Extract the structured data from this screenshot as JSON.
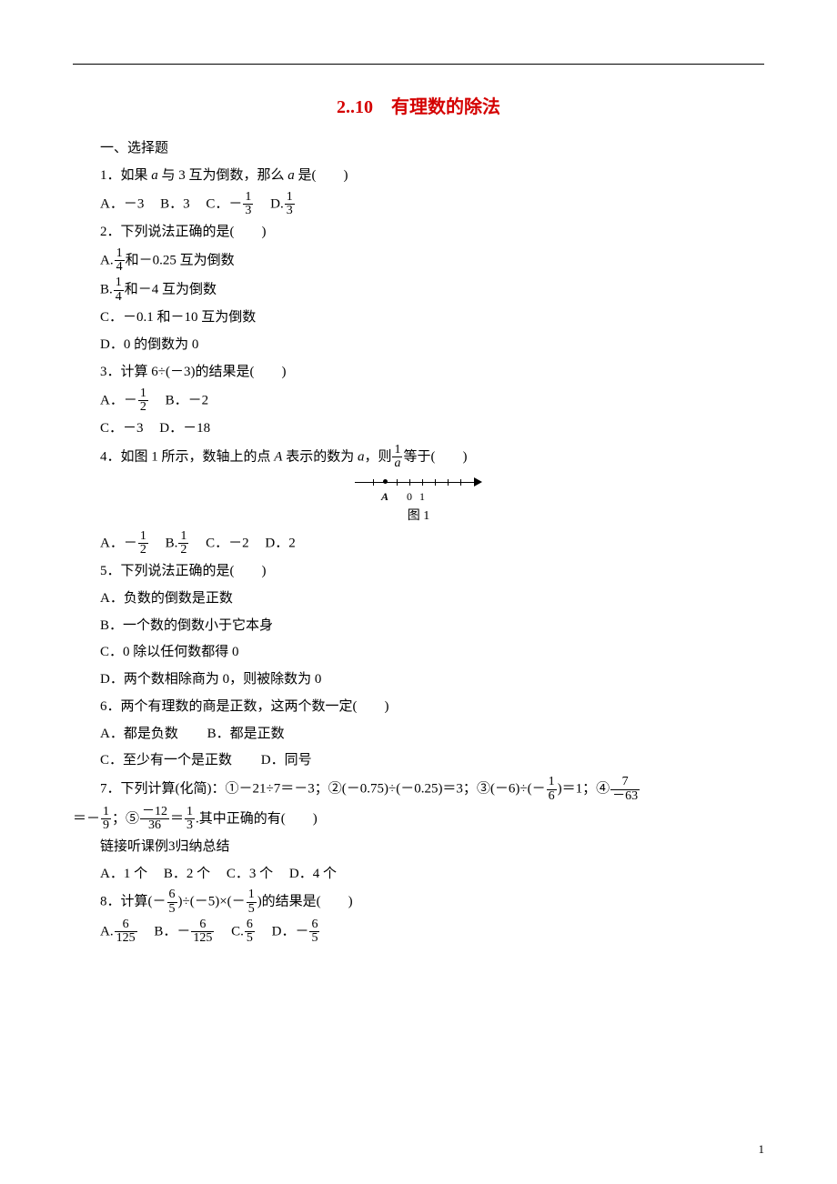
{
  "title": "2..10　有理数的除法",
  "section1": "一、选择题",
  "q1": {
    "stem_pre": "1．如果 ",
    "var_a": "a",
    "stem_mid": " 与 3 互为倒数，那么 ",
    "stem_end": " 是(　　)",
    "optA_pre": "A．－3",
    "optB_pre": "B．3",
    "optC_pre": "C．－",
    "optD_pre": "D.",
    "frac_num": "1",
    "frac_den": "3"
  },
  "q2": {
    "stem": "2．下列说法正确的是(　　)",
    "A_pre": "A.",
    "A_suf": "和－0.25 互为倒数",
    "A_num": "1",
    "A_den": "4",
    "B_pre": "B.",
    "B_suf": "和－4 互为倒数",
    "B_num": "1",
    "B_den": "4",
    "C": "C．－0.1 和－10 互为倒数",
    "D": "D．0 的倒数为 0"
  },
  "q3": {
    "stem": "3．计算 6÷(－3)的结果是(　　)",
    "A_pre": "A．－",
    "A_num": "1",
    "A_den": "2",
    "B": "B．－2",
    "C": "C．－3",
    "D": "D．－18"
  },
  "q4": {
    "stem_pre": "4．如图 1 所示，数轴上的点 ",
    "pointA": "A",
    "stem_mid": " 表示的数为 ",
    "var_a": "a",
    "stem_mid2": "，则",
    "frac_num": "1",
    "frac_den_var": "a",
    "stem_end": "等于(　　)",
    "caption": "图 1",
    "A_pre": "A．－",
    "A_num": "1",
    "A_den": "2",
    "B_pre": "B.",
    "B_num": "1",
    "B_den": "2",
    "C": "C．－2",
    "D": "D．2",
    "axis_A": "A",
    "axis_0": "0",
    "axis_1": "1"
  },
  "q5": {
    "stem": "5．下列说法正确的是(　　)",
    "A": "A．负数的倒数是正数",
    "B": "B．一个数的倒数小于它本身",
    "C": "C．0 除以任何数都得 0",
    "D": "D．两个数相除商为 0，则被除数为 0"
  },
  "q6": {
    "stem": "6．两个有理数的商是正数，这两个数一定(　　)",
    "A": "A．都是负数",
    "B": "B．都是正数",
    "C": "C．至少有一个是正数",
    "D": "D．同号"
  },
  "q7": {
    "stem_pre": "7．下列计算(化简)：①－21÷7＝－3；②(－0.75)÷(－0.25)＝3；③(－6)÷(－",
    "p3_num": "1",
    "p3_den": "6",
    "stem_mid": ")＝1；④",
    "p4_num": "7",
    "p4_den": "－63",
    "line2_pre": "＝－",
    "p4r_num": "1",
    "p4r_den": "9",
    "line2_mid": "；⑤",
    "p5_num": "－12",
    "p5_den": "36",
    "line2_eq": "＝",
    "p5r_num": "1",
    "p5r_den": "3",
    "line2_end": ".其中正确的有(　　)",
    "link": "链接听课例3归纳总结",
    "A": "A．1 个",
    "B": "B．2 个",
    "C": "C．3 个",
    "D": "D．4 个"
  },
  "q8": {
    "stem_pre": "8．计算(－",
    "f1_num": "6",
    "f1_den": "5",
    "stem_mid": ")÷(－5)×(－",
    "f2_num": "1",
    "f2_den": "5",
    "stem_end": ")的结果是(　　)",
    "A_pre": "A.",
    "A_num": "6",
    "A_den": "125",
    "B_pre": "B．－",
    "B_num": "6",
    "B_den": "125",
    "C_pre": "C.",
    "C_num": "6",
    "C_den": "5",
    "D_pre": "D．－",
    "D_num": "6",
    "D_den": "5"
  },
  "pagenum": "1"
}
